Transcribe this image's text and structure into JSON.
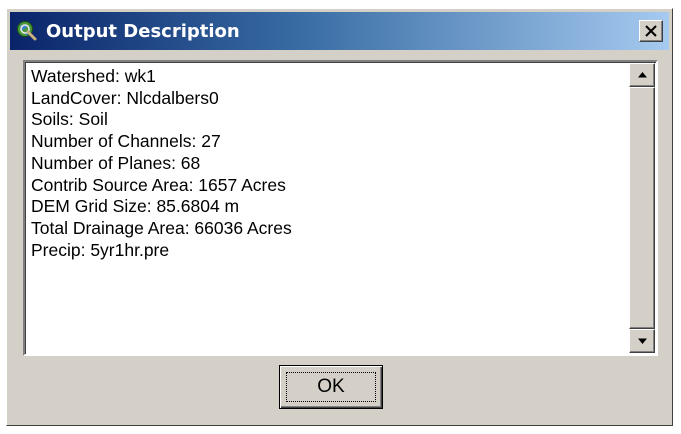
{
  "window": {
    "title": "Output Description",
    "app_icon": "globe-magnifier-icon",
    "close_icon": "close-icon"
  },
  "output": {
    "lines": [
      "Watershed: wk1",
      "LandCover: Nlcdalbers0",
      "Soils: Soil",
      "Number of Channels: 27",
      "Number of Planes: 68",
      "Contrib Source Area: 1657 Acres",
      "DEM Grid Size: 85.6804 m",
      "Total Drainage Area: 66036 Acres",
      "Precip: 5yr1hr.pre"
    ]
  },
  "scrollbar": {
    "up_icon": "arrow-up-icon",
    "down_icon": "arrow-down-icon"
  },
  "buttons": {
    "ok_label": "OK"
  },
  "colors": {
    "title_gradient_start": "#0a246a",
    "title_gradient_end": "#a6caf0",
    "face": "#d4d0c8"
  }
}
